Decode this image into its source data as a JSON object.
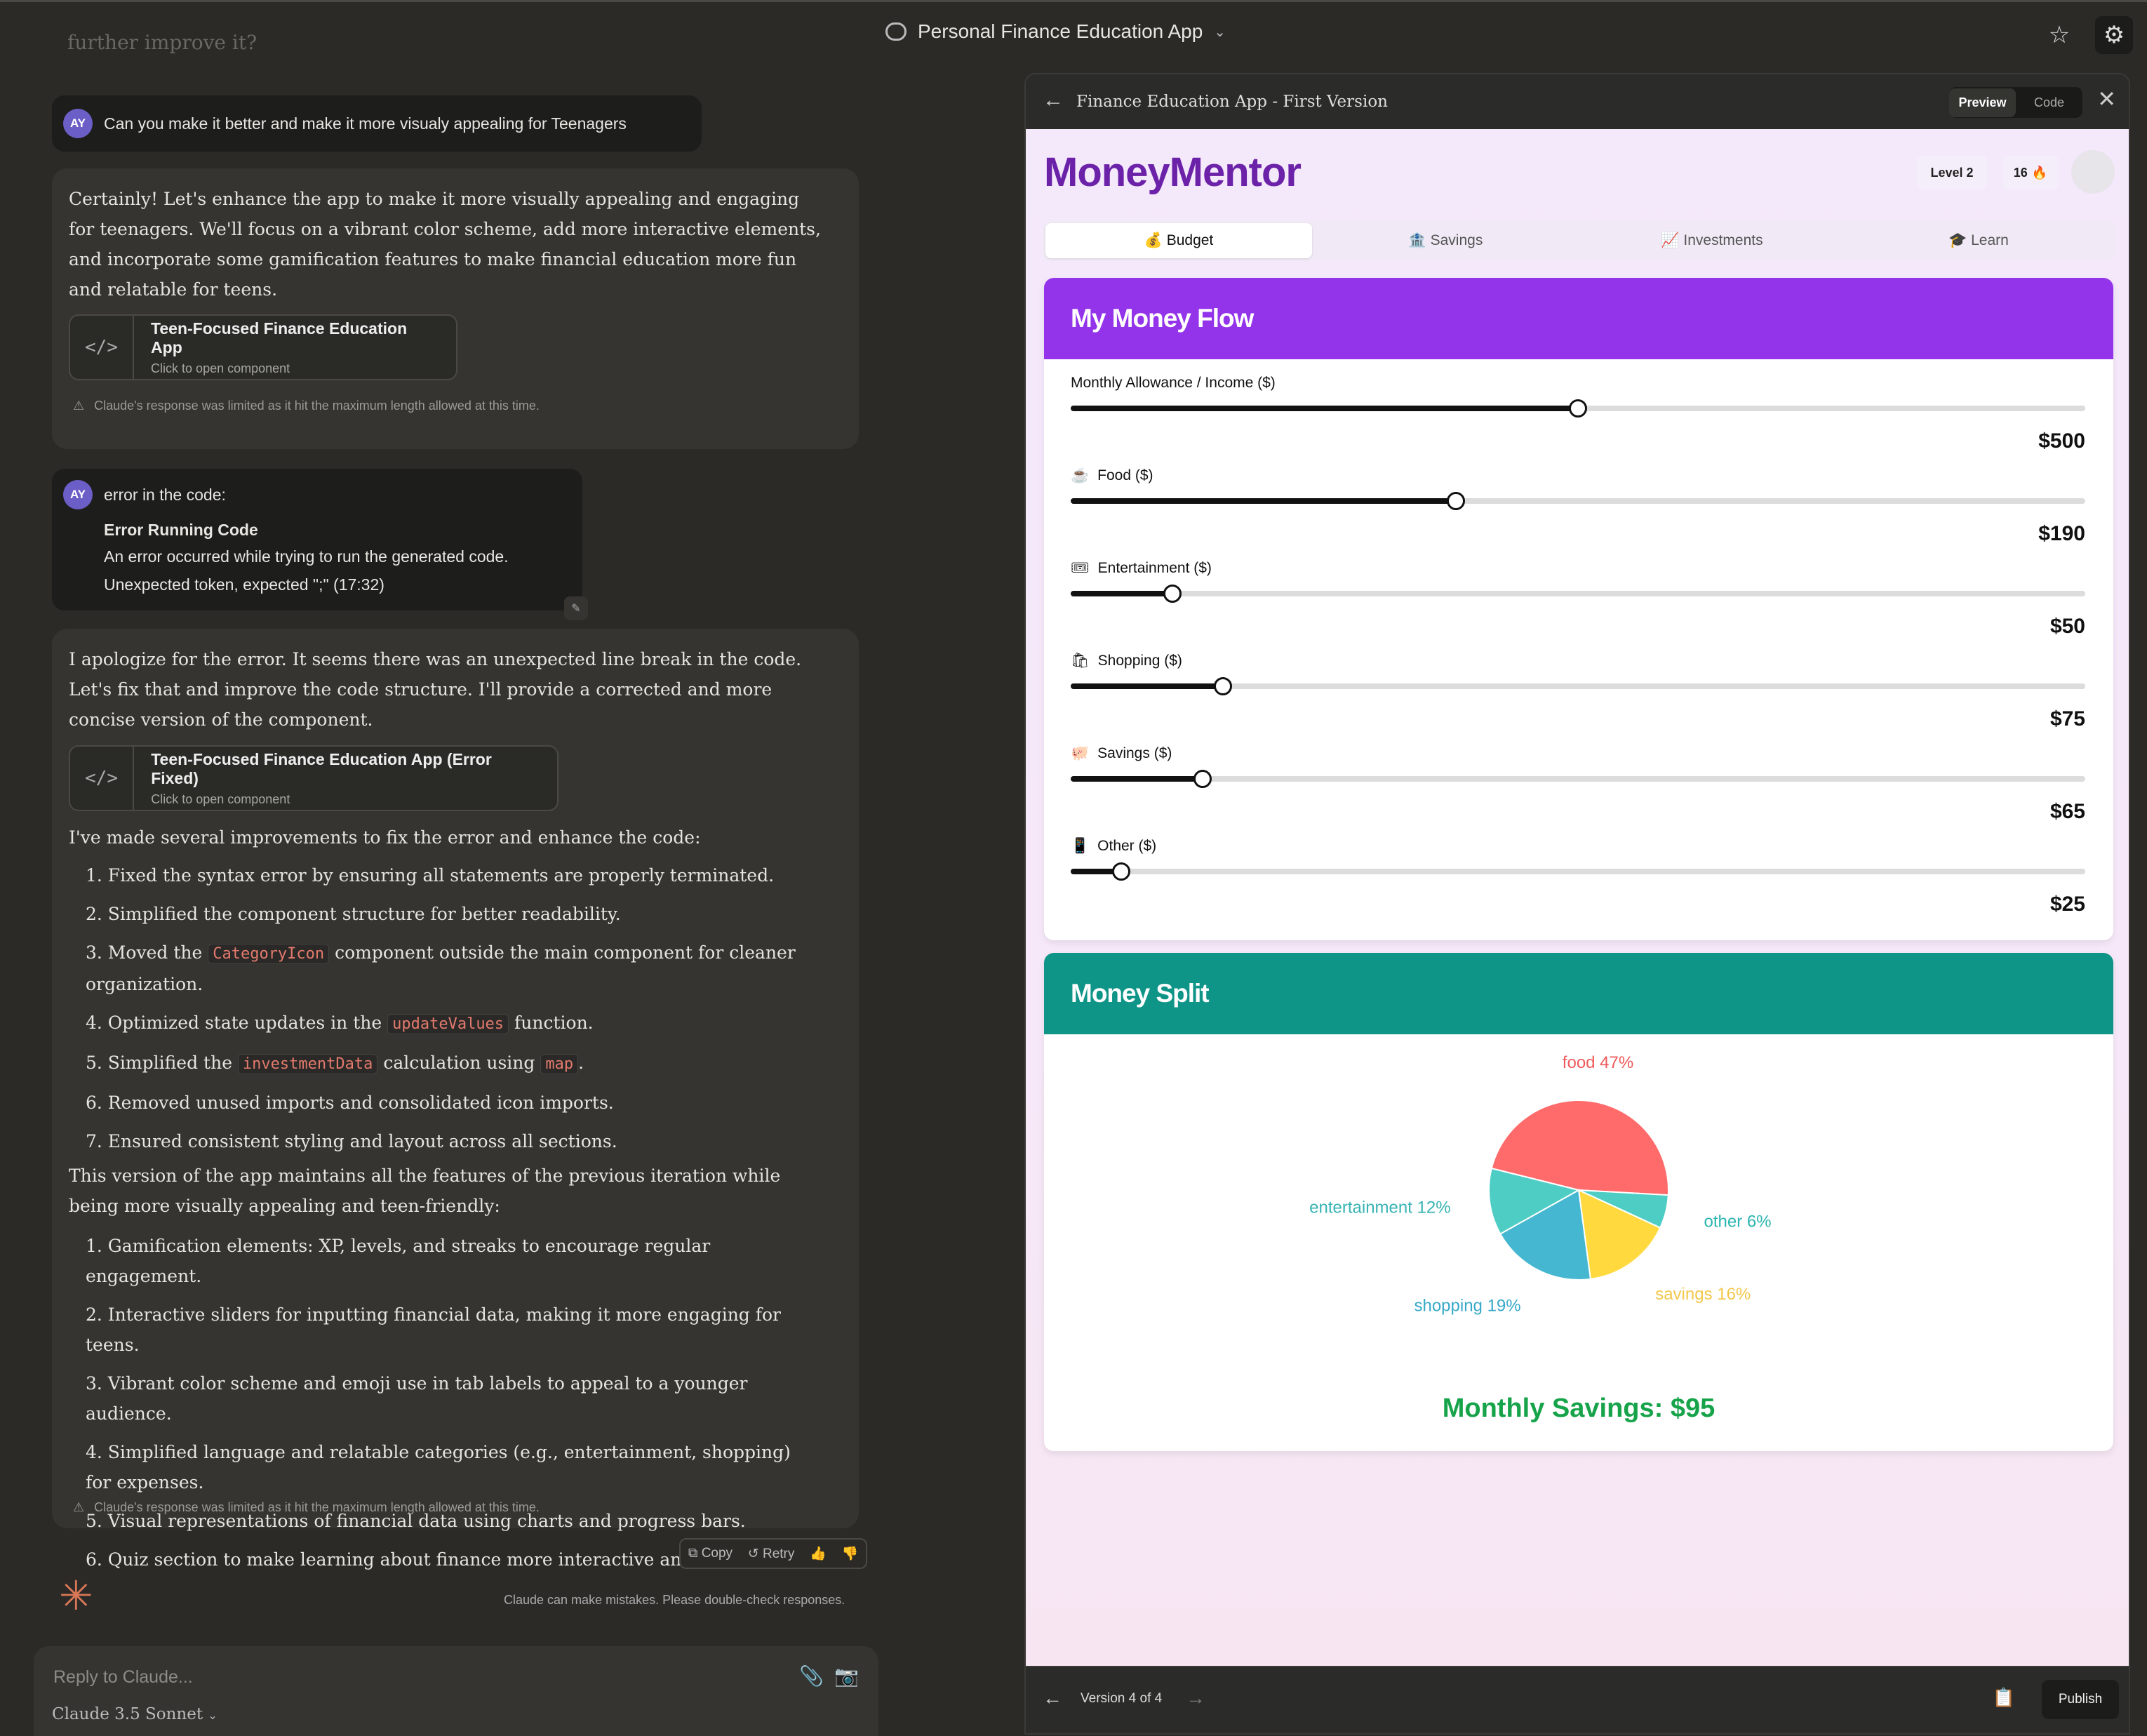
{
  "window": {
    "title": "Personal Finance Education App"
  },
  "chat": {
    "faded_text": "further improve it?",
    "messages": {
      "user1": {
        "avatar": "AY",
        "text": "Can you make it better and make it more visualy appealing for Teenagers"
      },
      "assistant1": {
        "text": "Certainly! Let's enhance the app to make it more visually appealing and engaging for teenagers. We'll focus on a vibrant color scheme, add more interactive elements, and incorporate some gamification features to make financial education more fun and relatable for teens.",
        "artifact_title": "Teen-Focused Finance Education App",
        "artifact_sub": "Click to open component",
        "warning": "Claude's response was limited as it hit the maximum length allowed at this time."
      },
      "user2": {
        "avatar": "AY",
        "line1": "error in the code:",
        "line2": "Error Running Code",
        "line3": "An error occurred while trying to run the generated code.",
        "line4": "Unexpected token, expected \";\" (17:32)"
      },
      "assistant2": {
        "intro": "I apologize for the error. It seems there was an unexpected line break in the code. Let's fix that and improve the code structure. I'll provide a corrected and more concise version of the component.",
        "artifact_title": "Teen-Focused Finance Education App (Error Fixed)",
        "artifact_sub": "Click to open component",
        "improvements_intro": "I've made several improvements to fix the error and enhance the code:",
        "improvements": {
          "i1": "1. Fixed the syntax error by ensuring all statements are properly terminated.",
          "i2": "2. Simplified the component structure for better readability.",
          "i3_a": "3. Moved the",
          "i3_code": "CategoryIcon",
          "i3_b": "component outside the main component for cleaner organization.",
          "i4_a": "4. Optimized state updates in the",
          "i4_code": "updateValues",
          "i4_b": "function.",
          "i5_a": "5. Simplified the",
          "i5_code": "investmentData",
          "i5_b": "calculation using",
          "i5_code2": "map",
          "i5_c": ".",
          "i6": "6. Removed unused imports and consolidated icon imports.",
          "i7": "7. Ensured consistent styling and layout across all sections."
        },
        "features_intro": "This version of the app maintains all the features of the previous iteration while being more visually appealing and teen-friendly:",
        "features": {
          "f1": "1. Gamification elements: XP, levels, and streaks to encourage regular engagement.",
          "f2": "2. Interactive sliders for inputting financial data, making it more engaging for teens.",
          "f3": "3. Vibrant color scheme and emoji use in tab labels to appeal to a younger audience.",
          "f4": "4. Simplified language and relatable categories (e.g., entertainment, shopping) for expenses.",
          "f5": "5. Visual representations of financial data using charts and progress bars.",
          "f6": "6. Quiz section to make learning about finance more interactive an"
        },
        "warning": "Claude's response was limited as it hit the maximum length allowed at this time."
      }
    },
    "actions": {
      "copy": "Copy",
      "retry": "Retry"
    },
    "disclaimer": "Claude can make mistakes. Please double-check responses.",
    "reply_placeholder": "Reply to Claude...",
    "model": "Claude 3.5 Sonnet"
  },
  "panel": {
    "title": "Finance Education App - First Version",
    "toggle": {
      "preview": "Preview",
      "code": "Code"
    },
    "version": "Version 4 of 4",
    "publish": "Publish"
  },
  "app": {
    "brand": "MoneyMentor",
    "level": "Level 2",
    "streak": "16",
    "streak_icon": "🔥",
    "tabs": {
      "budget": "💰 Budget",
      "savings": "🏦 Savings",
      "investments": "📈 Investments",
      "learn": "🎓 Learn"
    },
    "money_flow": {
      "title": "My Money Flow",
      "color": "#9333ea",
      "sliders": {
        "income": {
          "label": "Monthly Allowance / Income ($)",
          "value": "$500",
          "fraction": 0.5
        },
        "food": {
          "label": "Food ($)",
          "value": "$190",
          "fraction": 0.38
        },
        "entertainment": {
          "label": "Entertainment ($)",
          "value": "$50",
          "fraction": 0.1
        },
        "shopping": {
          "label": "Shopping ($)",
          "value": "$75",
          "fraction": 0.15
        },
        "savings": {
          "label": "Savings ($)",
          "value": "$65",
          "fraction": 0.13
        },
        "other": {
          "label": "Other ($)",
          "value": "$25",
          "fraction": 0.05
        }
      }
    },
    "money_split": {
      "title": "Money Split",
      "color": "#0f9488",
      "monthly_savings": "Monthly Savings: $95"
    }
  },
  "chart_data": {
    "type": "pie",
    "categories": [
      "food",
      "other",
      "savings",
      "shopping",
      "entertainment"
    ],
    "values": [
      47,
      6,
      16,
      19,
      12
    ],
    "labels": [
      "food 47%",
      "other 6%",
      "savings 16%",
      "shopping 19%",
      "entertainment 12%"
    ],
    "colors": [
      "#ff6b6b",
      "#4ecdc4",
      "#ffd93d",
      "#45b7d1",
      "#4ecdc4"
    ],
    "title": "",
    "legend": "none"
  }
}
